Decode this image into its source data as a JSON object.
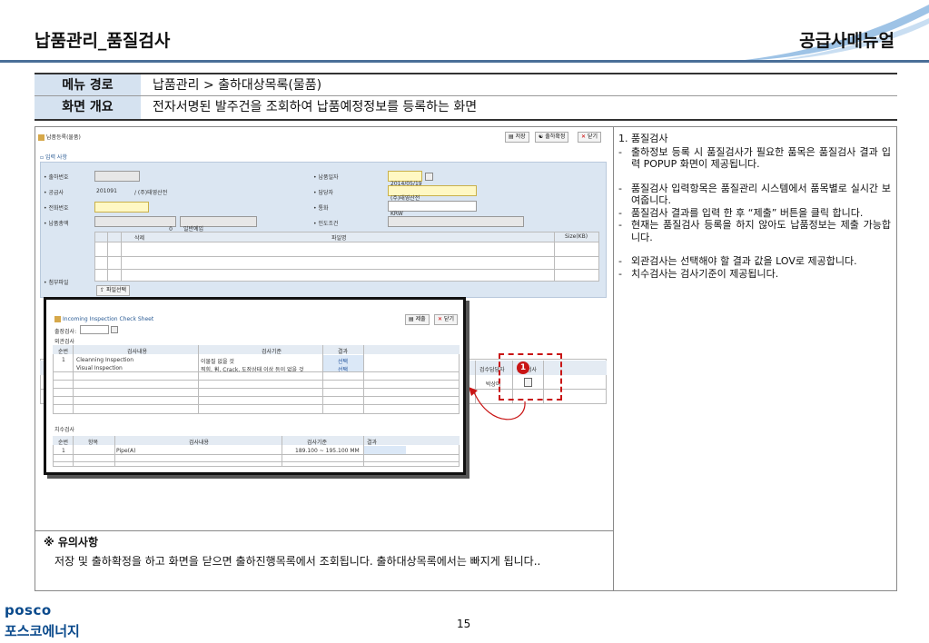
{
  "header": {
    "title": "납품관리_품질검사",
    "brand": "공급사매뉴얼"
  },
  "info": {
    "menu_label": "메뉴 경로",
    "menu_value": "납품관리 > 출하대상목록(물품)",
    "overview_label": "화면 개요",
    "overview_value": "전자서명된 발주건을 조회하여 납품예정정보를 등록하는 화면"
  },
  "screen": {
    "tab_title": "납품등록(물품)",
    "section_input": "▫ 입력 사항",
    "buttons": {
      "save": "저장",
      "confirm": "출하확정",
      "close": "닫기"
    },
    "labels": {
      "ship_no": "• 출하번호",
      "supplier": "• 공급사",
      "phone": "• 전화번호",
      "total": "• 납품총액",
      "attach": "• 첨부파일",
      "delivery_date": "• 납품일자",
      "manager": "• 담당자",
      "currency": "• 통화",
      "terms": "• 인도조건"
    },
    "values": {
      "supplier_code": "201091",
      "supplier_name": "/ (주)태영산전",
      "total_amount": "0",
      "total_type": "일반예입",
      "delivery_date": "2014/05/19",
      "manager": "(주)태영산전",
      "currency": "KRW"
    },
    "file_cols": [
      "삭제",
      "파일명",
      "Size(KB)"
    ],
    "file_btn": "파일선택",
    "grid_cols": [
      "검수담당자",
      "품질검사"
    ],
    "grid_val": "박상미"
  },
  "popup": {
    "title": "Incoming Inspection Check Sheet",
    "ship_label": "출장검사:",
    "submit": "제출",
    "close": "닫기",
    "section1": "외관검사",
    "cols1": [
      "순번",
      "검사내용",
      "검사기준",
      "결과"
    ],
    "rows1": [
      {
        "no": "1",
        "content": "Cleanning Inspection",
        "std": "이물질 없을 것",
        "result": "선택"
      },
      {
        "no": "",
        "content": "Visual Inspection",
        "std": "찍힘, 휨, Crack, 도장상태 이상 등이 없을 것",
        "result": "선택"
      }
    ],
    "section2": "치수검사",
    "cols2": [
      "순번",
      "항목",
      "검사내용",
      "검사기준",
      "결과"
    ],
    "rows2": [
      {
        "no": "1",
        "item": "",
        "content": "Pipe(A)",
        "std": "189.100 ~ 195.100 MM",
        "result": ""
      }
    ]
  },
  "callout": {
    "badge": "1"
  },
  "caution": {
    "title": "※ 유의사항",
    "text": "저장 및 출하확정을 하고 화면을 닫으면 출하진행목록에서 조회됩니다. 출하대상목록에서는 빠지게 됩니다.."
  },
  "notes": {
    "heading": "1. 품질검사",
    "items1": [
      "출하정보 등록 시 품질검사가 필요한 품목은 품질검사 결과 입력 POPUP 화면이 제공됩니다."
    ],
    "items2": [
      "품질검사 입력항목은 품질관리 시스템에서 품목별로 실시간 보여줍니다.",
      "품질검사 결과를 입력 한 후 “제출” 버튼을 클릭 합니다.",
      "현재는 품질검사 등록을 하지 않아도 납품정보는 제출 가능합니다."
    ],
    "items3": [
      "외관검사는 선택해야 할 결과 값을 LOV로 제공합니다.",
      "치수검사는 검사기준이 제공됩니다."
    ]
  },
  "footer": {
    "logo_en": "posco",
    "logo_ko": "포스코에너지",
    "page": "15"
  },
  "colors": {
    "accent": "#4a6f98",
    "label_bg": "#d5e2f0",
    "callout": "#c91515",
    "logo": "#0a4a8c"
  }
}
